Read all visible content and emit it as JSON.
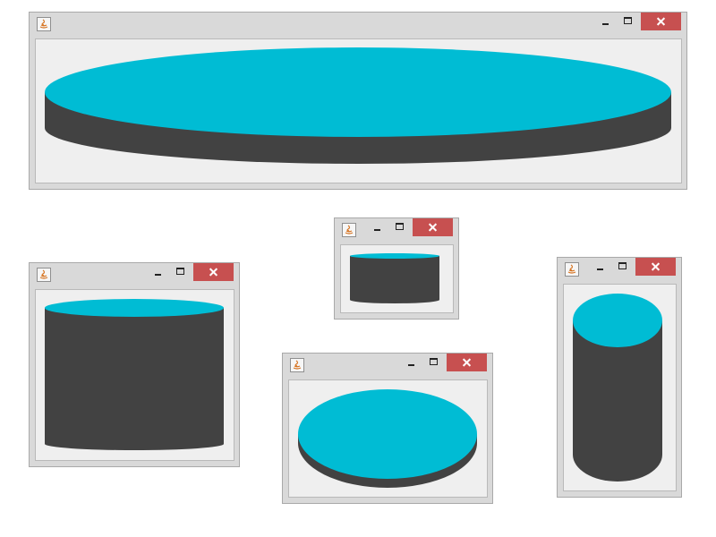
{
  "colors": {
    "cylinder_top": "#00bcd4",
    "cylinder_side": "#424242",
    "close_button": "#c75050",
    "client_background": "#efefef",
    "window_frame": "#d9d9d9"
  },
  "icons": {
    "app": "java-icon",
    "minimize": "minimize-icon",
    "maximize": "maximize-icon",
    "close": "close-icon"
  },
  "windows": [
    {
      "shape": "wide-flat-cylinder"
    },
    {
      "shape": "small-short-cylinder"
    },
    {
      "shape": "square-tall-cylinder"
    },
    {
      "shape": "disc-cylinder"
    },
    {
      "shape": "narrow-tall-cylinder"
    }
  ]
}
